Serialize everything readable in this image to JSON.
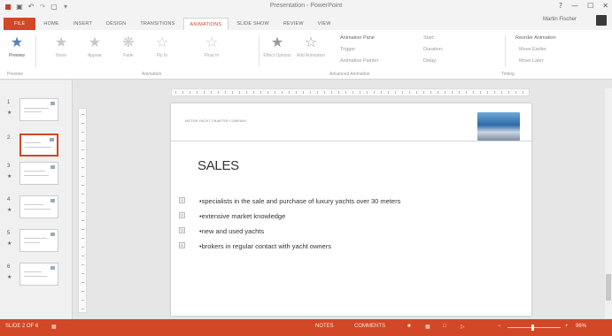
{
  "window": {
    "title": "Presentation - PowerPoint",
    "controls": [
      "?",
      "—",
      "☐",
      "✕"
    ],
    "signin": "Martin Fischer"
  },
  "qat": {
    "icons": [
      "powerpoint-logo-icon",
      "save-icon",
      "undo-icon",
      "redo-icon",
      "start-slideshow-icon",
      "customize-icon"
    ]
  },
  "tabs": [
    {
      "label": "FILE"
    },
    {
      "label": "HOME"
    },
    {
      "label": "INSERT"
    },
    {
      "label": "DESIGN"
    },
    {
      "label": "TRANSITIONS"
    },
    {
      "label": "ANIMATIONS"
    },
    {
      "label": "SLIDE SHOW"
    },
    {
      "label": "REVIEW"
    },
    {
      "label": "VIEW"
    }
  ],
  "ribbon": {
    "preview_label": "Preview",
    "effects": [
      {
        "label": "None"
      },
      {
        "label": "Appear"
      },
      {
        "label": "Fade"
      },
      {
        "label": "Fly In"
      },
      {
        "label": "Float In"
      }
    ],
    "effect_options_label": "Effect Options",
    "add_animation_label": "Add Animation",
    "animation_pane": "Animation Pane",
    "trigger": "Trigger",
    "animation_painter": "Animation Painter",
    "start": "Start:",
    "duration": "Duration:",
    "delay": "Delay:",
    "reorder": "Reorder Animation",
    "move_earlier": "Move Earlier",
    "move_later": "Move Later",
    "groups": {
      "preview": "Preview",
      "animation": "Animation",
      "advanced": "Advanced Animation",
      "timing": "Timing"
    }
  },
  "slides": [
    {
      "number": "1",
      "star": "★"
    },
    {
      "number": "2",
      "star": ""
    },
    {
      "number": "3",
      "star": "★"
    },
    {
      "number": "4",
      "star": "★"
    },
    {
      "number": "5",
      "star": "★"
    },
    {
      "number": "6",
      "star": "★"
    }
  ],
  "slide": {
    "header_text": "MOTOR YACHT CHARTER COMPANY",
    "title": "SALES",
    "bullets": [
      {
        "badge": "1",
        "text": "specialists in the sale and purchase of luxury yachts over 30 meters"
      },
      {
        "badge": "2",
        "text": "extensive market knowledge"
      },
      {
        "badge": "3",
        "text": "new and used yachts"
      },
      {
        "badge": "4",
        "text": "brokers in regular contact with yacht owners"
      }
    ]
  },
  "status": {
    "slide_info": "SLIDE 2 OF 6",
    "notes": "NOTES",
    "comments": "COMMENTS",
    "zoom": "96%"
  },
  "colors": {
    "accent": "#d24726",
    "ribbon_bg": "#ffffff",
    "workspace_bg": "#e6e6e6"
  }
}
